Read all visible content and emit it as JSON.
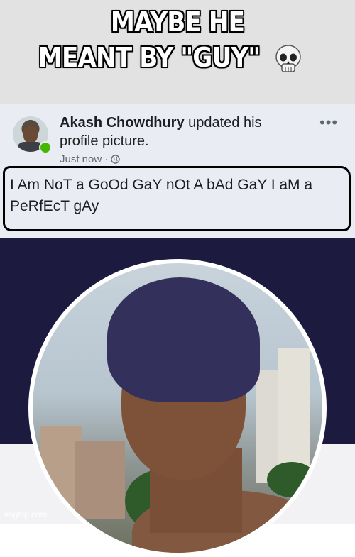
{
  "meme": {
    "caption_line1": "MAYBE HE",
    "caption_line2": "MEANT BY \"GUY\"",
    "emoji_icon": "skull-icon"
  },
  "post": {
    "author_name": "Akash Chowdhury",
    "action_text": " updated his profile picture.",
    "timestamp": "Just now",
    "privacy_separator": "·",
    "privacy_icon": "globe-icon",
    "more_label": "•••",
    "status_text": "I Am NoT a GoOd GaY nOt A bAd GaY I aM a PeRfEcT gAy"
  },
  "watermark": "imgflip.com",
  "colors": {
    "caption_bg": "#e2e2e2",
    "post_bg": "#e9edf3",
    "cover_bg": "#1d1a40",
    "online_dot": "#44b700"
  }
}
